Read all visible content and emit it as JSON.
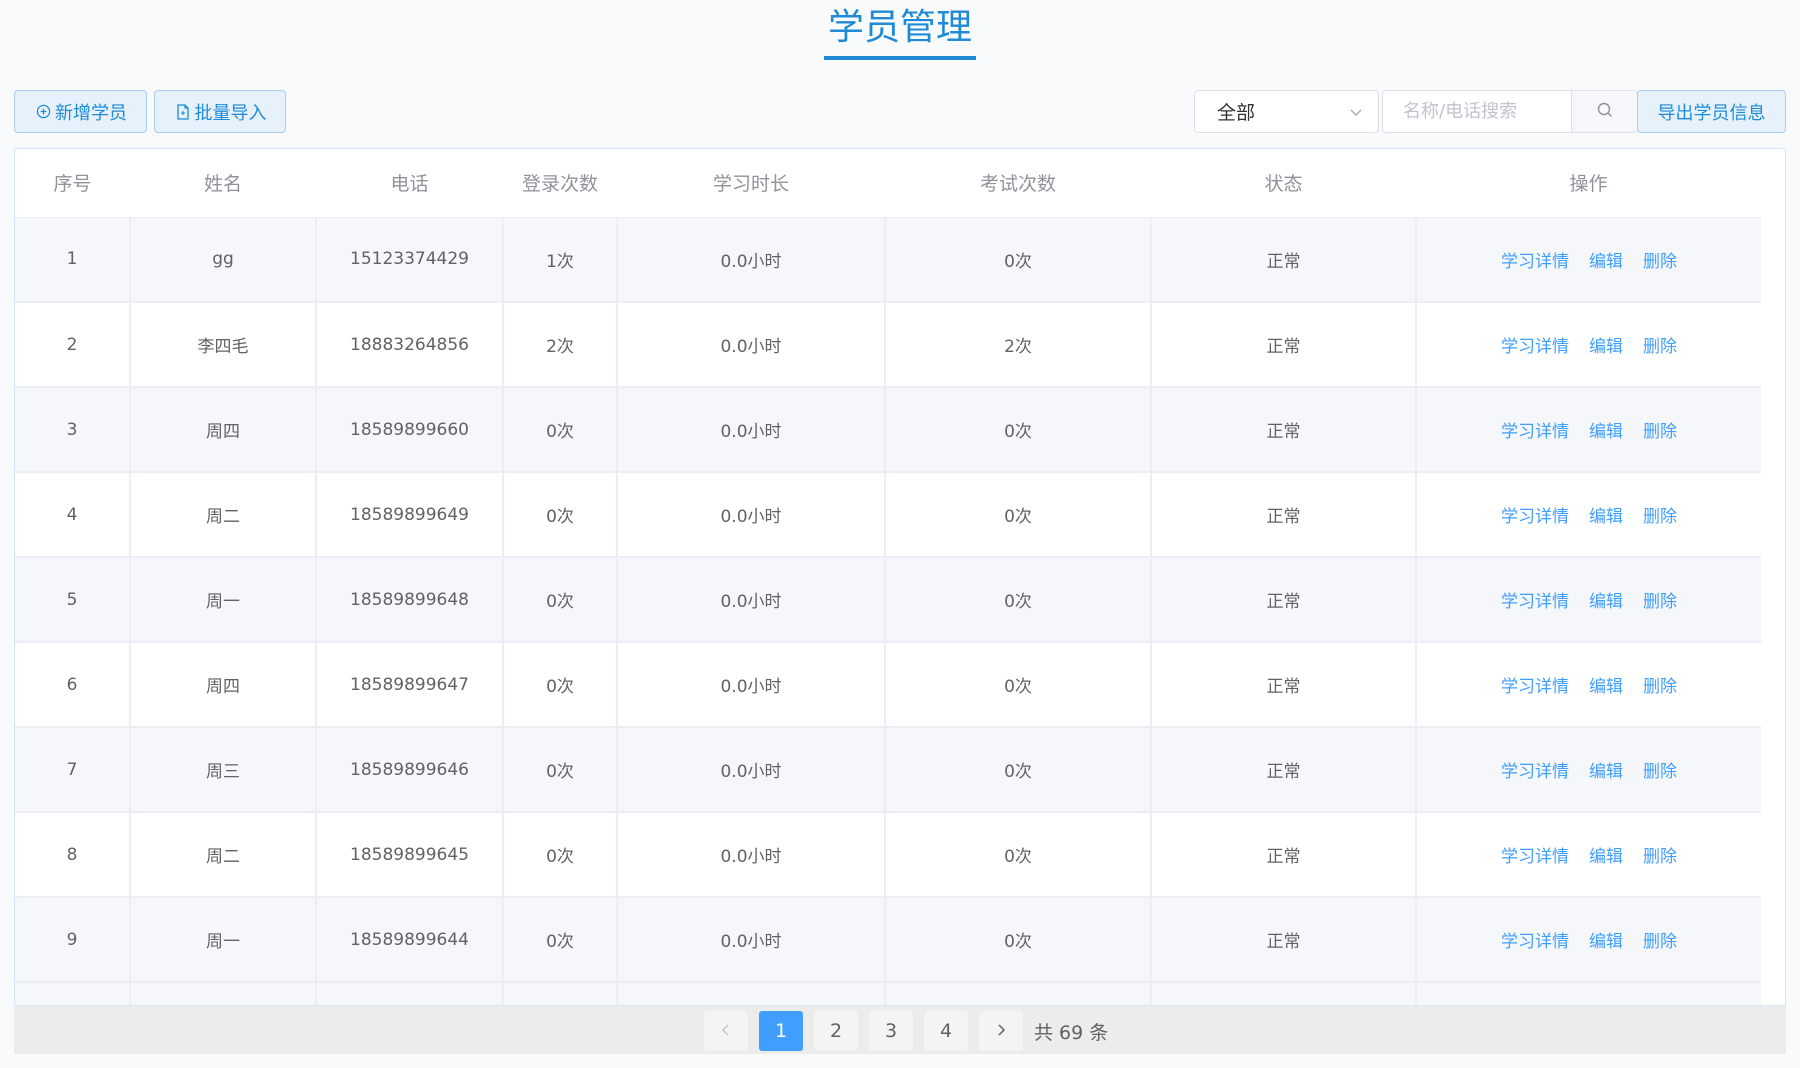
{
  "title": "学员管理",
  "toolbar": {
    "add_label": "新增学员",
    "import_label": "批量导入",
    "export_label": "导出学员信息",
    "filter_selected": "全部",
    "search_placeholder": "名称/电话搜索"
  },
  "table": {
    "headers": [
      "序号",
      "姓名",
      "电话",
      "登录次数",
      "学习时长",
      "考试次数",
      "状态",
      "操作"
    ],
    "actions": {
      "detail": "学习详情",
      "edit": "编辑",
      "delete": "删除"
    },
    "rows": [
      [
        "1",
        "gg",
        "15123374429",
        "1次",
        "0.0小时",
        "0次",
        "正常"
      ],
      [
        "2",
        "李四毛",
        "18883264856",
        "2次",
        "0.0小时",
        "2次",
        "正常"
      ],
      [
        "3",
        "周四",
        "18589899660",
        "0次",
        "0.0小时",
        "0次",
        "正常"
      ],
      [
        "4",
        "周二",
        "18589899649",
        "0次",
        "0.0小时",
        "0次",
        "正常"
      ],
      [
        "5",
        "周一",
        "18589899648",
        "0次",
        "0.0小时",
        "0次",
        "正常"
      ],
      [
        "6",
        "周四",
        "18589899647",
        "0次",
        "0.0小时",
        "0次",
        "正常"
      ],
      [
        "7",
        "周三",
        "18589899646",
        "0次",
        "0.0小时",
        "0次",
        "正常"
      ],
      [
        "8",
        "周二",
        "18589899645",
        "0次",
        "0.0小时",
        "0次",
        "正常"
      ],
      [
        "9",
        "周一",
        "18589899644",
        "0次",
        "0.0小时",
        "0次",
        "正常"
      ]
    ]
  },
  "pagination": {
    "pages": [
      "1",
      "2",
      "3",
      "4"
    ],
    "current": "1",
    "total_text": "共 69 条"
  },
  "icons": {
    "add": "plus-circle-icon",
    "import": "document-icon",
    "search": "search-icon",
    "select": "chevron-down-icon",
    "prev": "chevron-left-icon",
    "next": "chevron-right-icon"
  },
  "colors": {
    "accent": "#409eff",
    "title": "#1f8bd6"
  }
}
